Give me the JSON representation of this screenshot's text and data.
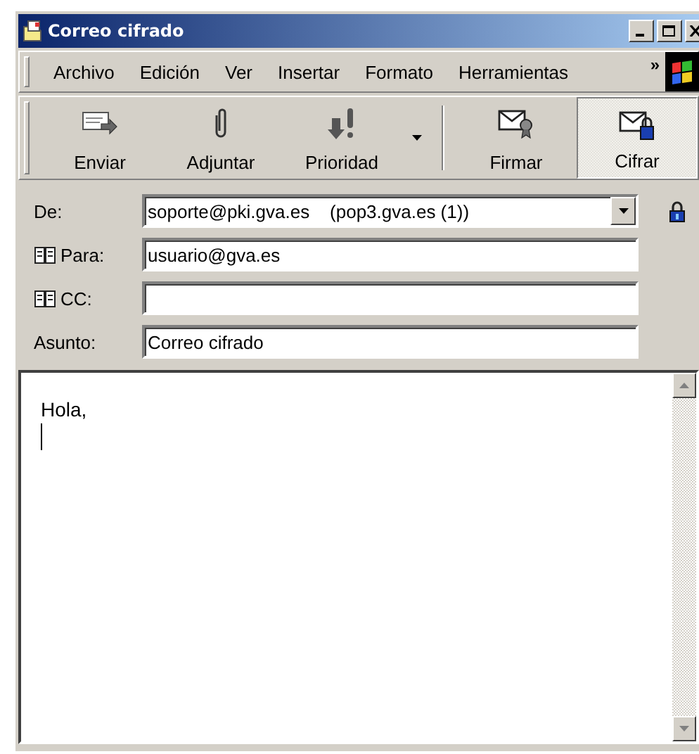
{
  "window": {
    "title": "Correo cifrado"
  },
  "menu": [
    "Archivo",
    "Edición",
    "Ver",
    "Insertar",
    "Formato",
    "Herramientas"
  ],
  "menu_overflow": "»",
  "toolbar": [
    {
      "label": "Enviar",
      "kind": "send",
      "pressed": false,
      "dropdown": false
    },
    {
      "label": "Adjuntar",
      "kind": "attach",
      "pressed": false,
      "dropdown": false
    },
    {
      "label": "Prioridad",
      "kind": "priority",
      "pressed": false,
      "dropdown": true
    },
    {
      "label": "Firmar",
      "kind": "sign",
      "pressed": false,
      "dropdown": false
    },
    {
      "label": "Cifrar",
      "kind": "encrypt",
      "pressed": true,
      "dropdown": false
    }
  ],
  "fields": [
    {
      "label": "De:",
      "kind": "dropdown",
      "value": "soporte@pki.gva.es    (pop3.gva.es (1))"
    },
    {
      "label": "Para:",
      "kind": "address",
      "value": "usuario@gva.es"
    },
    {
      "label": "CC:",
      "kind": "address"
    },
    {
      "label": "Asunto:",
      "kind": "text",
      "value": "Correo cifrado"
    }
  ],
  "body": {
    "text": "Hola,"
  }
}
